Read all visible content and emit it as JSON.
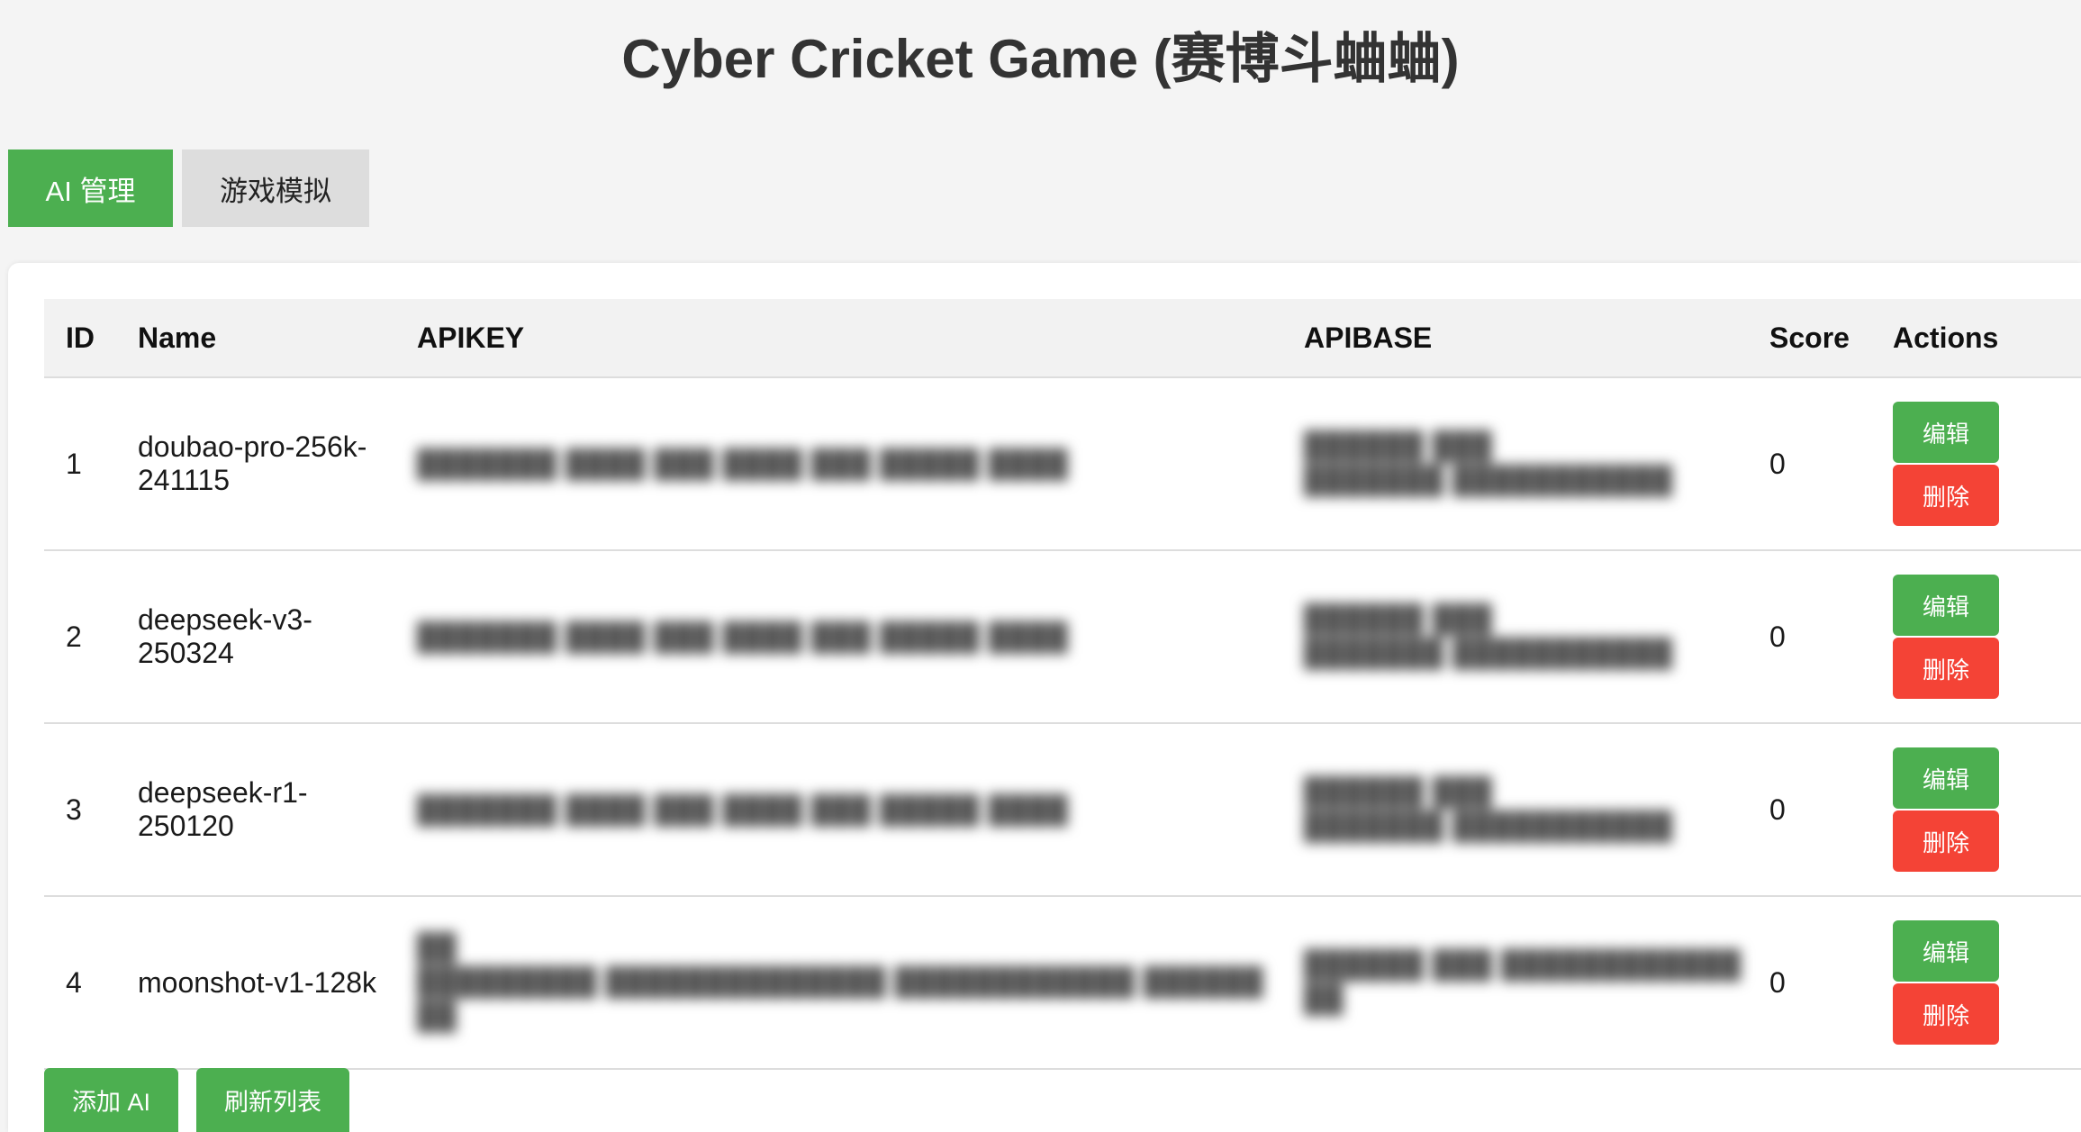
{
  "page": {
    "title": "Cyber Cricket Game (赛博斗蛐蛐)"
  },
  "tabs": [
    {
      "label": "AI 管理",
      "active": true
    },
    {
      "label": "游戏模拟",
      "active": false
    }
  ],
  "table": {
    "headers": [
      "ID",
      "Name",
      "APIKEY",
      "APIBASE",
      "Score",
      "Actions"
    ],
    "rows": [
      {
        "id": "1",
        "name": "doubao-pro-256k-241115",
        "apikey": "",
        "apibase": "",
        "score": "0"
      },
      {
        "id": "2",
        "name": "deepseek-v3-250324",
        "apikey": "",
        "apibase": "",
        "score": "0"
      },
      {
        "id": "3",
        "name": "deepseek-r1-250120",
        "apikey": "",
        "apibase": "",
        "score": "0"
      },
      {
        "id": "4",
        "name": "moonshot-v1-128k",
        "apikey": "",
        "apibase": "",
        "score": "0"
      }
    ],
    "edit_label": "编辑",
    "delete_label": "删除"
  },
  "footer": {
    "add_label": "添加 AI",
    "refresh_label": "刷新列表"
  },
  "colors": {
    "primary": "#4caf50",
    "danger": "#f44336",
    "background": "#f4f4f4",
    "inactive_tab": "#dddddd"
  }
}
